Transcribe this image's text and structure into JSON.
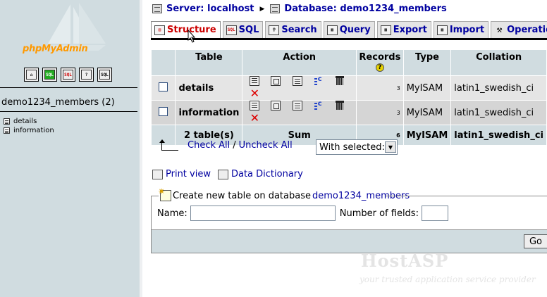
{
  "left": {
    "logo": "phpMyAdmin",
    "nav_icons": [
      "home-icon",
      "query-window-icon",
      "sql-icon",
      "documentation-icon",
      "sql-docs-icon"
    ],
    "database": "demo1234_members (2)",
    "tables": [
      "details",
      "information"
    ]
  },
  "breadcrumb": {
    "server": "Server: localhost",
    "database": "Database: demo1234_members"
  },
  "tabs": [
    {
      "label": "Structure",
      "icon": "structure-icon",
      "active": true
    },
    {
      "label": "SQL",
      "icon": "sql-icon"
    },
    {
      "label": "Search",
      "icon": "search-icon"
    },
    {
      "label": "Query",
      "icon": "query-icon"
    },
    {
      "label": "Export",
      "icon": "export-icon"
    },
    {
      "label": "Import",
      "icon": "import-icon"
    },
    {
      "label": "Operations",
      "icon": "operations-icon"
    }
  ],
  "table": {
    "headers": {
      "table": "Table",
      "action": "Action",
      "records": "Records",
      "type": "Type",
      "collation": "Collation"
    },
    "rows": [
      {
        "name": "details",
        "records": "3",
        "type": "MyISAM",
        "collation": "latin1_swedish_ci"
      },
      {
        "name": "information",
        "records": "3",
        "type": "MyISAM",
        "collation": "latin1_swedish_ci"
      }
    ],
    "summary": {
      "tables": "2 table(s)",
      "label": "Sum",
      "records": "6",
      "type": "MyISAM",
      "collation": "latin1_swedish_ci"
    }
  },
  "checks": {
    "check_all": "Check All",
    "separator": "/",
    "uncheck_all": "Uncheck All",
    "with_selected": "With selected:"
  },
  "links": {
    "print_view": "Print view",
    "data_dictionary": "Data Dictionary"
  },
  "create_table": {
    "legend_prefix": "Create new table on database",
    "legend_db": "demo1234_members",
    "name_label": "Name:",
    "fields_label": "Number of fields:",
    "go": "Go"
  },
  "watermark": {
    "brand": "HostASP",
    "tagline": "your trusted application service provider"
  },
  "colors": {
    "sidebar_bg": "#d0dce0",
    "link": "#0000a0",
    "active_tab": "#cc0000",
    "logo": "#ff9900"
  }
}
